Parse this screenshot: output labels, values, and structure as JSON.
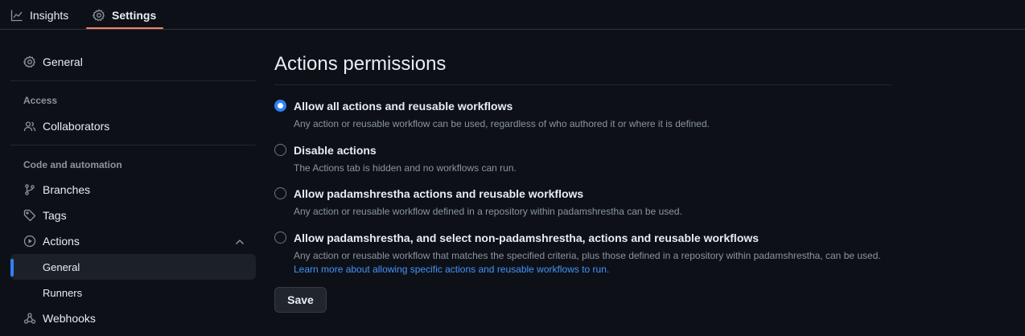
{
  "topnav": {
    "tabs": [
      {
        "label": "Insights",
        "icon": "graph-icon"
      },
      {
        "label": "Settings",
        "icon": "gear-icon",
        "selected": true
      }
    ]
  },
  "sidebar": {
    "general": "General",
    "access_heading": "Access",
    "collaborators": "Collaborators",
    "code_heading": "Code and automation",
    "branches": "Branches",
    "tags": "Tags",
    "actions": "Actions",
    "actions_sub": {
      "general": "General",
      "runners": "Runners"
    },
    "webhooks": "Webhooks",
    "active_item": "General"
  },
  "main": {
    "title": "Actions permissions",
    "options": [
      {
        "label": "Allow all actions and reusable workflows",
        "desc": "Any action or reusable workflow can be used, regardless of who authored it or where it is defined.",
        "checked": true
      },
      {
        "label": "Disable actions",
        "desc": "The Actions tab is hidden and no workflows can run.",
        "checked": false
      },
      {
        "label": "Allow padamshrestha actions and reusable workflows",
        "desc": "Any action or reusable workflow defined in a repository within padamshrestha can be used.",
        "checked": false
      },
      {
        "label": "Allow padamshrestha, and select non-padamshrestha, actions and reusable workflows",
        "desc": "Any action or reusable workflow that matches the specified criteria, plus those defined in a repository within padamshrestha, can be used.",
        "link": "Learn more about allowing specific actions and reusable workflows to run.",
        "checked": false
      }
    ],
    "save_label": "Save"
  },
  "colors": {
    "accent": "#2f81f7",
    "tab_underline": "#f78166",
    "background": "#0d1117",
    "link": "#4493f8"
  }
}
